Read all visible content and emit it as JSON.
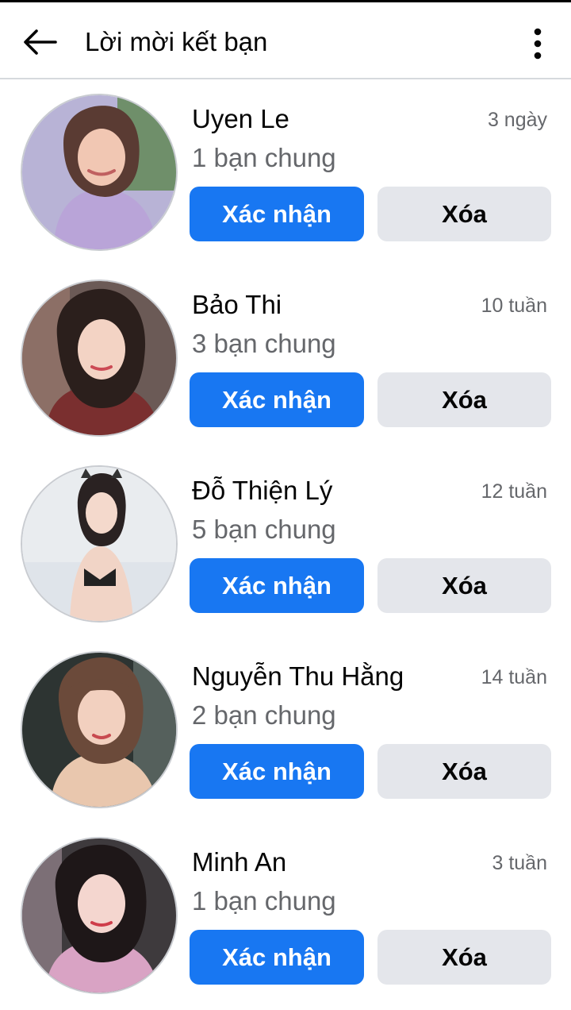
{
  "header": {
    "title": "Lời mời kết bạn",
    "back_icon": "arrow-left-icon",
    "more_icon": "vertical-ellipsis-icon"
  },
  "colors": {
    "primary": "#1877f2",
    "secondary_button": "#e4e6eb",
    "text": "#050505",
    "muted_text": "#65676b"
  },
  "requests": [
    {
      "name": "Uyen Le",
      "time": "3 ngày",
      "mutual": "1 bạn chung",
      "confirm_label": "Xác nhận",
      "delete_label": "Xóa"
    },
    {
      "name": "Bảo Thi",
      "time": "10 tuần",
      "mutual": "3 bạn chung",
      "confirm_label": "Xác nhận",
      "delete_label": "Xóa"
    },
    {
      "name": "Đỗ Thiện Lý",
      "time": "12 tuần",
      "mutual": "5 bạn chung",
      "confirm_label": "Xác nhận",
      "delete_label": "Xóa"
    },
    {
      "name": "Nguyễn Thu Hằng",
      "time": "14 tuần",
      "mutual": "2 bạn chung",
      "confirm_label": "Xác nhận",
      "delete_label": "Xóa"
    },
    {
      "name": "Minh An",
      "time": "3 tuần",
      "mutual": "1 bạn chung",
      "confirm_label": "Xác nhận",
      "delete_label": "Xóa"
    }
  ]
}
